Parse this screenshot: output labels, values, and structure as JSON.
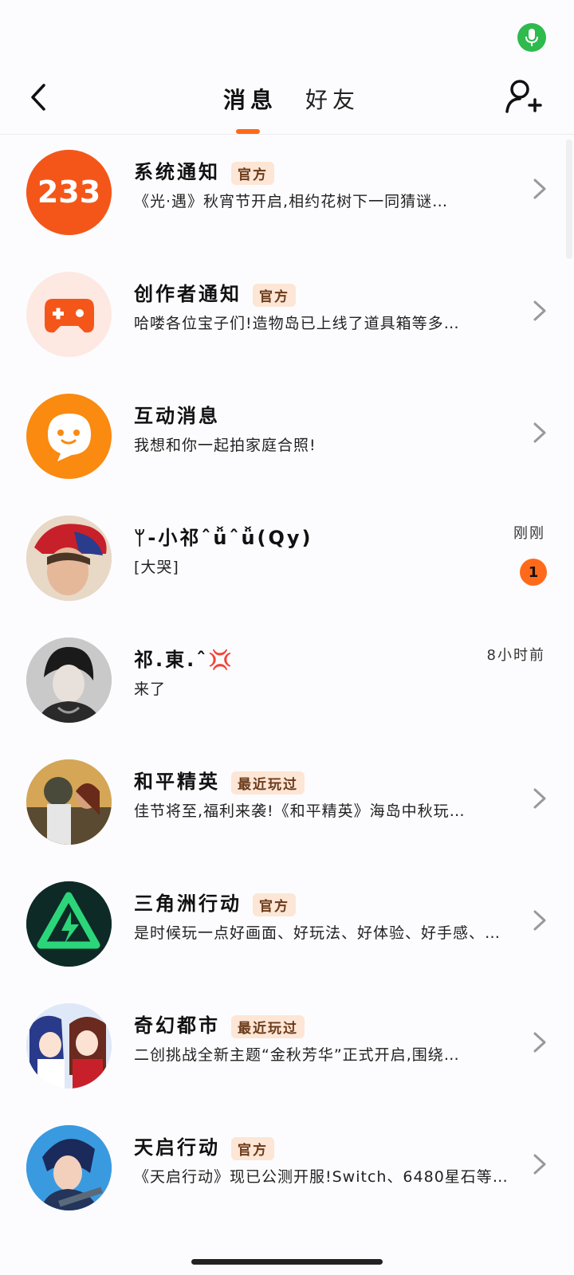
{
  "header": {
    "tabs": [
      {
        "label": "消息",
        "active": true
      },
      {
        "label": "好友",
        "active": false
      }
    ]
  },
  "colors": {
    "accent": "#ff6a1a",
    "mic": "#2fba4e",
    "badge_bg": "#fde6d6"
  },
  "messages": [
    {
      "name": "系统通知",
      "badge": "官方",
      "preview": "《光·遇》秋宵节开启,相约花树下一同猜谜…",
      "avatar_icon": "233-logo-icon"
    },
    {
      "name": "创作者通知",
      "badge": "官方",
      "preview": "哈喽各位宝子们!造物岛已上线了道具箱等多…",
      "avatar_icon": "gamepad-icon"
    },
    {
      "name": "互动消息",
      "badge": "",
      "preview": "我想和你一起拍家庭合照!",
      "avatar_icon": "chat-face-icon"
    },
    {
      "name": "ᛘ-小祁ˆǚˆǚ(Qy)",
      "time": "刚刚",
      "unread": "1",
      "preview": "[大哭]",
      "avatar_icon": "user-avatar"
    },
    {
      "name": "祁.東.ˆ💢",
      "time": "8小时前",
      "preview": "来了",
      "avatar_icon": "user-avatar"
    },
    {
      "name": "和平精英",
      "badge": "最近玩过",
      "preview": "佳节将至,福利来袭!《和平精英》海岛中秋玩…",
      "avatar_icon": "game-avatar"
    },
    {
      "name": "三角洲行动",
      "badge": "官方",
      "preview": "是时候玩一点好画面、好玩法、好体验、好手感、…",
      "avatar_icon": "delta-logo-icon"
    },
    {
      "name": "奇幻都市",
      "badge": "最近玩过",
      "preview": "二创挑战全新主题“金秋芳华”正式开启,围绕…",
      "avatar_icon": "game-avatar"
    },
    {
      "name": "天启行动",
      "badge": "官方",
      "preview": "《天启行动》现已公测开服!Switch、6480星石等…",
      "avatar_icon": "game-avatar"
    }
  ]
}
